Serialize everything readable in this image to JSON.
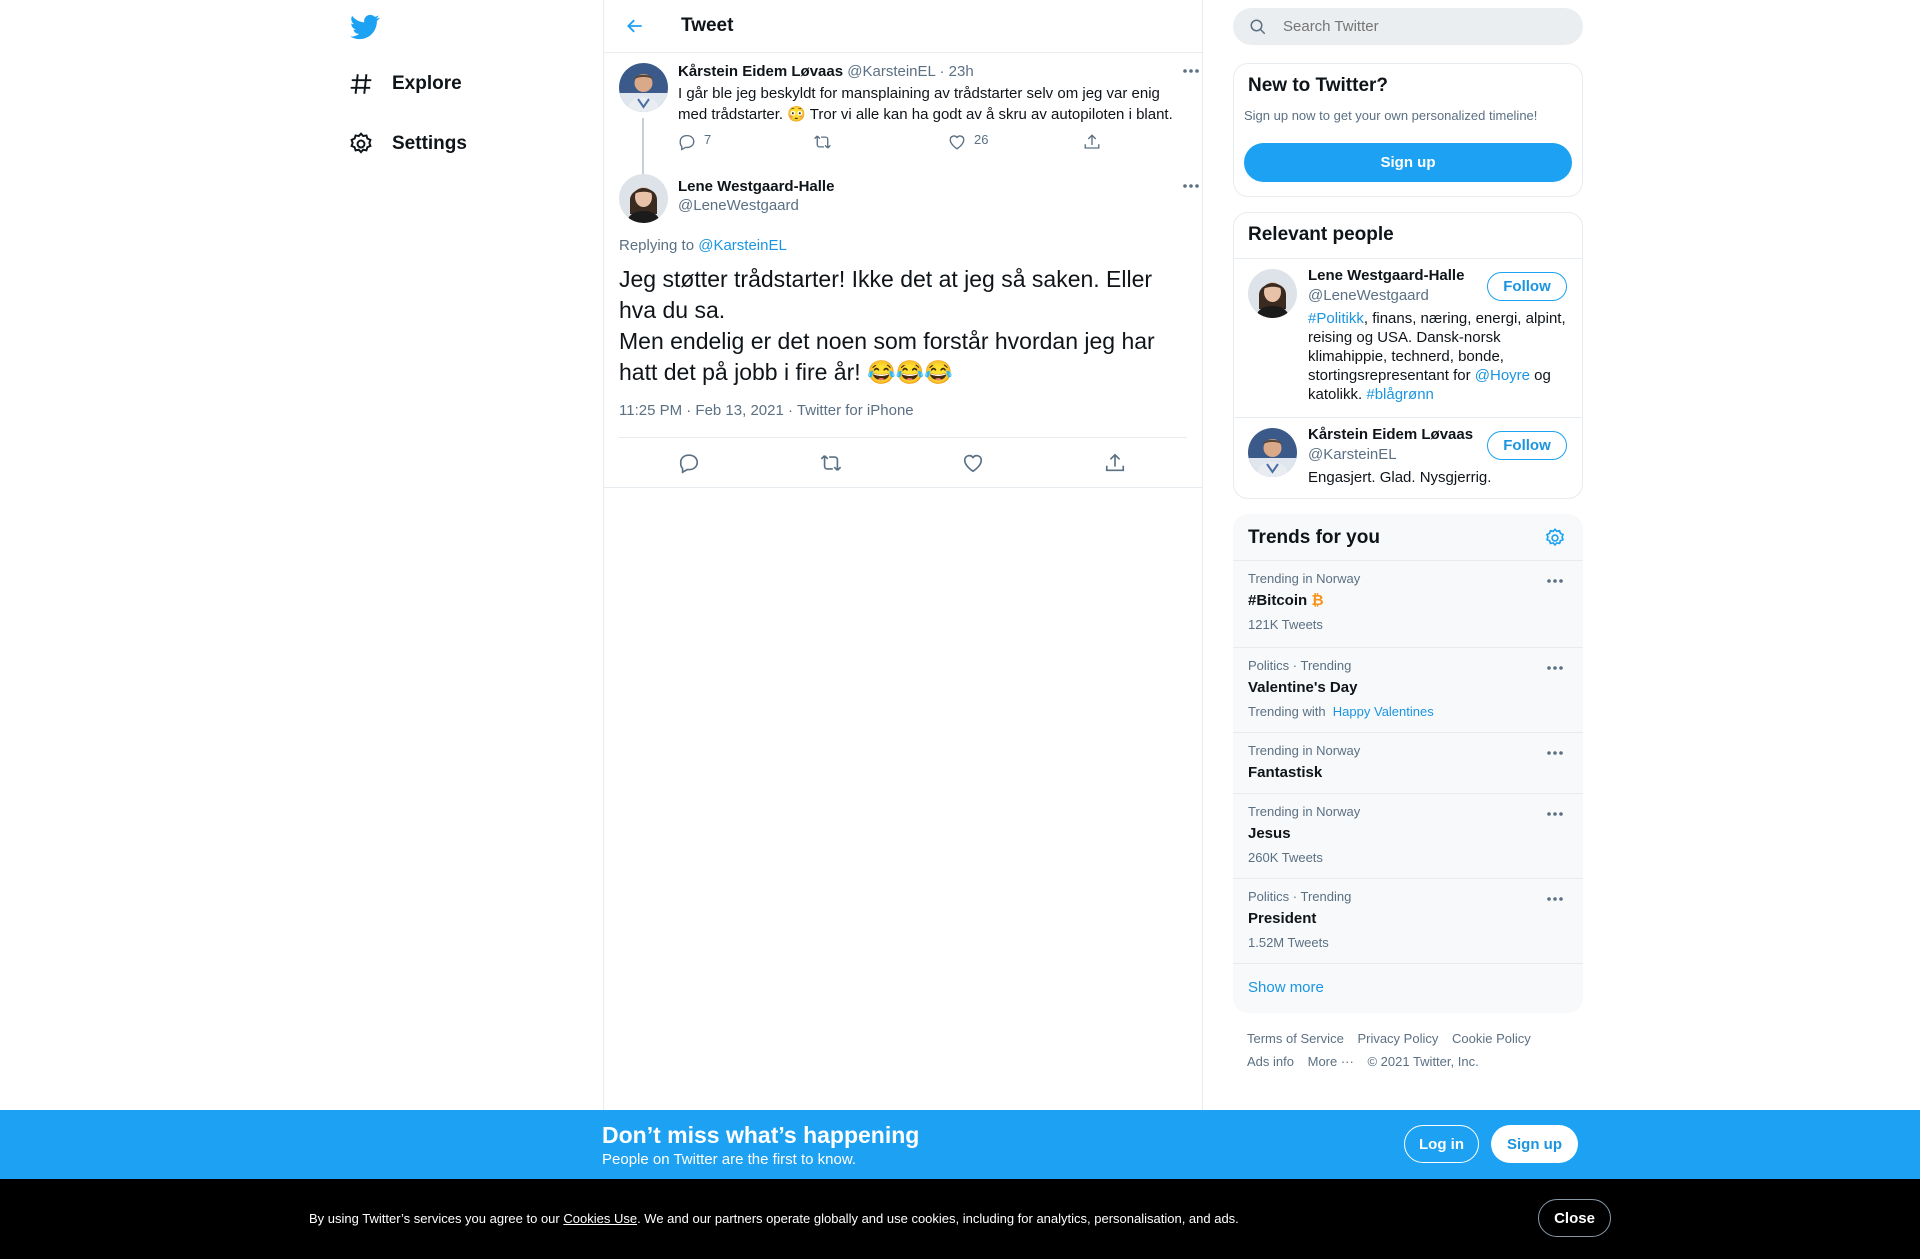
{
  "nav": {
    "explore": "Explore",
    "settings": "Settings"
  },
  "header": {
    "title": "Tweet"
  },
  "parent_tweet": {
    "name": "Kårstein Eidem Løvaas",
    "handle": "@KarsteinEL",
    "separator": "·",
    "age": "23h",
    "text": "I går ble jeg beskyldt for mansplaining av trådstarter selv om jeg var enig med trådstarter. 😳 Tror vi alle kan ha godt av å skru av autopiloten i blant.",
    "replies": "7",
    "likes": "26"
  },
  "main_tweet": {
    "name": "Lene Westgaard-Halle",
    "handle": "@LeneWestgaard",
    "replying_prefix": "Replying to",
    "replying_to": "@KarsteinEL",
    "line1": "Jeg støtter trådstarter! Ikke det at jeg så saken. Eller hva du sa.",
    "line2": "Men endelig er det noen som forstår hvordan jeg har hatt det på jobb i fire år! 😂😂😂",
    "time": "11:25 PM · Feb 13, 2021",
    "separator": "·",
    "source": "Twitter for iPhone"
  },
  "search": {
    "placeholder": "Search Twitter"
  },
  "new_to_twitter": {
    "title": "New to Twitter?",
    "subtitle": "Sign up now to get your own personalized timeline!",
    "button": "Sign up"
  },
  "relevant_people": {
    "title": "Relevant people",
    "people": [
      {
        "name": "Lene Westgaard-Halle",
        "handle": "@LeneWestgaard",
        "follow": "Follow",
        "bio_tag1": "#Politikk",
        "bio_text1": ", finans, næring, energi, alpint, reising og USA. Dansk-norsk klimahippie, technerd, bonde, stortingsrepresentant for ",
        "bio_mention": "@Hoyre",
        "bio_text2": " og katolikk. ",
        "bio_tag2": "#blågrønn"
      },
      {
        "name": "Kårstein Eidem Løvaas",
        "handle": "@KarsteinEL",
        "follow": "Follow",
        "bio": "Engasjert. Glad. Nysgjerrig."
      }
    ]
  },
  "trends": {
    "title": "Trends for you",
    "items": [
      {
        "context": "Trending in Norway",
        "name": "#Bitcoin",
        "sub": "121K Tweets"
      },
      {
        "context": "Politics · Trending",
        "name": "Valentine's Day",
        "sub": "Trending with",
        "sub_link": "Happy Valentines"
      },
      {
        "context": "Trending in Norway",
        "name": "Fantastisk",
        "sub": ""
      },
      {
        "context": "Trending in Norway",
        "name": "Jesus",
        "sub": "260K Tweets"
      },
      {
        "context": "Politics · Trending",
        "name": "President",
        "sub": "1.52M Tweets"
      }
    ],
    "show_more": "Show more"
  },
  "footer": {
    "terms": "Terms of Service",
    "privacy": "Privacy Policy",
    "cookie": "Cookie Policy",
    "ads": "Ads info",
    "more": "More ···",
    "copyright": "© 2021 Twitter, Inc."
  },
  "bottom_bar": {
    "title": "Don’t miss what’s happening",
    "subtitle": "People on Twitter are the first to know.",
    "login": "Log in",
    "signup": "Sign up"
  },
  "cookie": {
    "prefix": "By using Twitter’s services you agree to our ",
    "link": "Cookies Use",
    "suffix": ". We and our partners operate globally and use cookies, including for analytics, personalisation, and ads.",
    "close": "Close"
  },
  "colors": {
    "accent": "#1da1f2",
    "link": "#1b95e0",
    "bitcoin": "#f7931a"
  }
}
